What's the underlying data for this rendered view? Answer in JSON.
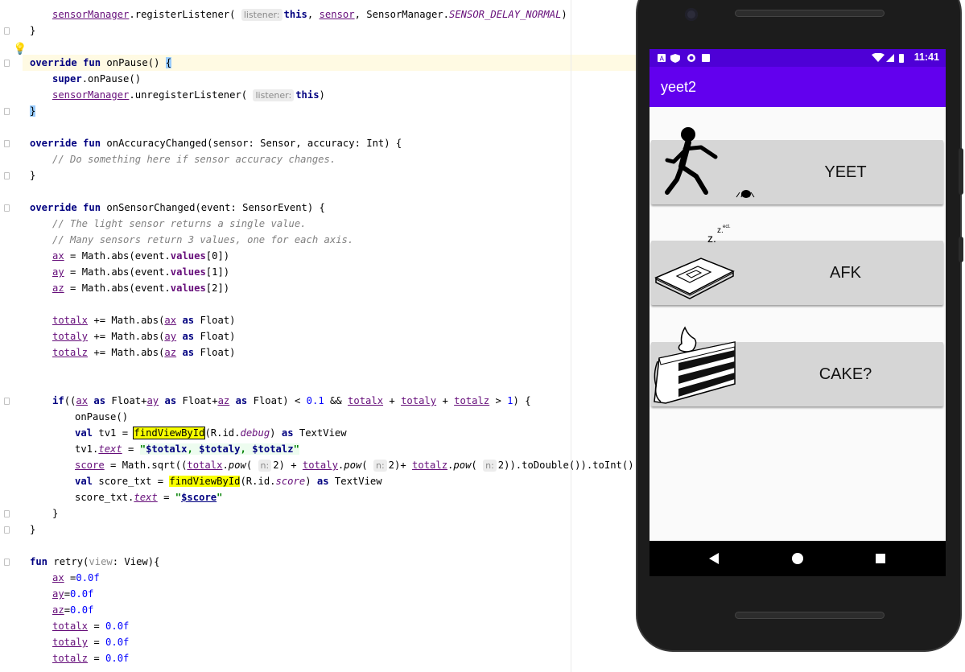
{
  "editor": {
    "code": {
      "l01_a": "sensorManager",
      "l01_b": ".registerListener( ",
      "l01_hint": "listener:",
      "l01_c": "this",
      "l01_d": ", ",
      "l01_e": "sensor",
      "l01_f": ", SensorManager.",
      "l01_g": "SENSOR_DELAY_NORMAL",
      "l01_h": ")",
      "brace_close": "}",
      "l03_kw1": "override fun",
      "l03_a": " onPause() ",
      "l03_b": "{",
      "l04_kw": "super",
      "l04_a": ".onPause()",
      "l05_a": "sensorManager",
      "l05_b": ".unregisterListener( ",
      "l05_hint": "listener:",
      "l05_c": "this",
      "l05_d": ")",
      "l08_kw": "override fun",
      "l08_a": " onAccuracyChanged(sensor: Sensor, accuracy: Int) {",
      "l09_cmt": "// Do something here if sensor accuracy changes.",
      "l12_kw": "override fun",
      "l12_a": " onSensorChanged(event: SensorEvent) {",
      "l13_cmt": "// The light sensor returns a single value.",
      "l14_cmt": "// Many sensors return 3 values, one for each axis.",
      "v_ax": "ax",
      "v_ay": "ay",
      "v_az": "az",
      "v_totalx": "totalx",
      "v_totaly": "totaly",
      "v_totalz": "totalz",
      "assign_abs": " = Math.abs(event.",
      "values": "values",
      "idx0": "[0])",
      "idx1": "[1])",
      "idx2": "[2])",
      "plus_eq_abs": " += Math.abs(",
      "as_kw": "as",
      "float_close": " Float)",
      "l24_if": "if",
      "l24_a": "((",
      "l24_b": " Float+",
      "l24_c": " Float) < ",
      "l24_num01": "0.1",
      "l24_d": " && ",
      "plus": " + ",
      "l24_e": " > ",
      "l24_num1": "1",
      "l24_f": ") {",
      "l25": "onPause()",
      "val_kw": "val",
      "l26_a": " tv1 = ",
      "findview": "findViewById",
      "l26_b": "(R.id.",
      "l26_debug": "debug",
      "l26_c": ") ",
      "l26_d": " TextView",
      "l27_a": "tv1.",
      "text": "text",
      "l27_b": " = ",
      "q": "\"",
      "tmpl_totalx": "$totalx",
      "tmpl_totaly": "$totaly",
      "tmpl_totalz": "$totalz",
      "comma_sp": ", ",
      "score": "score",
      "l28_a": " = Math.sqrt((",
      "pow": "pow",
      "dot": ".",
      "lparen": "( ",
      "n_hint": "n:",
      "two": "2",
      "l28_close1": ") + ",
      "l28_close2": ")+ ",
      "l28_end": ")).toDouble()).toInt()",
      "l29_a": " score_txt = ",
      "l29_score": "score",
      "l30_a": "score_txt.",
      "tmpl_score": "$score",
      "l34_kw": "fun",
      "l34_a": " retry(",
      "l34_view": "view",
      "l34_b": ": View){",
      "r_ax": " =",
      "r_eq": "=",
      "r_sp_eq": " = ",
      "zero": "0.0f"
    }
  },
  "phone": {
    "status": {
      "time": "11:41"
    },
    "app_title": "yeet2",
    "cards": [
      {
        "label": "YEET",
        "icon": "running-person-icon"
      },
      {
        "label": "AFK",
        "icon": "sleeping-device-icon"
      },
      {
        "label": "CAKE?",
        "icon": "cake-slice-icon"
      }
    ],
    "afk_zz": "z.",
    "afk_zz_small": "z.",
    "afk_ect": "ect."
  },
  "colors": {
    "statusbar": "#4e00d6",
    "appbar": "#6200ee",
    "card": "#d6d6d6",
    "keyword": "#000080",
    "field": "#660e7a",
    "highlight": "#f8ff00"
  }
}
